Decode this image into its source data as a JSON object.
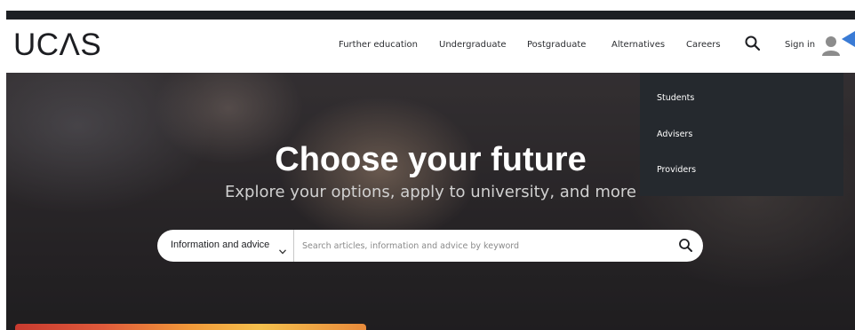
{
  "brand": {
    "logo_text": "UCΛS"
  },
  "nav": {
    "items": [
      {
        "label": "Further education"
      },
      {
        "label": "Undergraduate"
      },
      {
        "label": "Postgraduate"
      },
      {
        "label": "Alternatives"
      },
      {
        "label": "Careers"
      }
    ],
    "sign_in": "Sign in"
  },
  "hero": {
    "title": "Choose your future",
    "subtitle": "Explore your options, apply to university, and more"
  },
  "search": {
    "category": "Information and advice",
    "placeholder": "Search articles, information and advice by keyword"
  },
  "signin_menu": {
    "items": [
      {
        "label": "Students"
      },
      {
        "label": "Advisers"
      },
      {
        "label": "Providers"
      }
    ]
  },
  "colors": {
    "topbar": "#1d2024",
    "dropdown_bg": "#25292e",
    "text_dark": "#1d1e22",
    "pointer_blue": "#3a7bd5"
  }
}
